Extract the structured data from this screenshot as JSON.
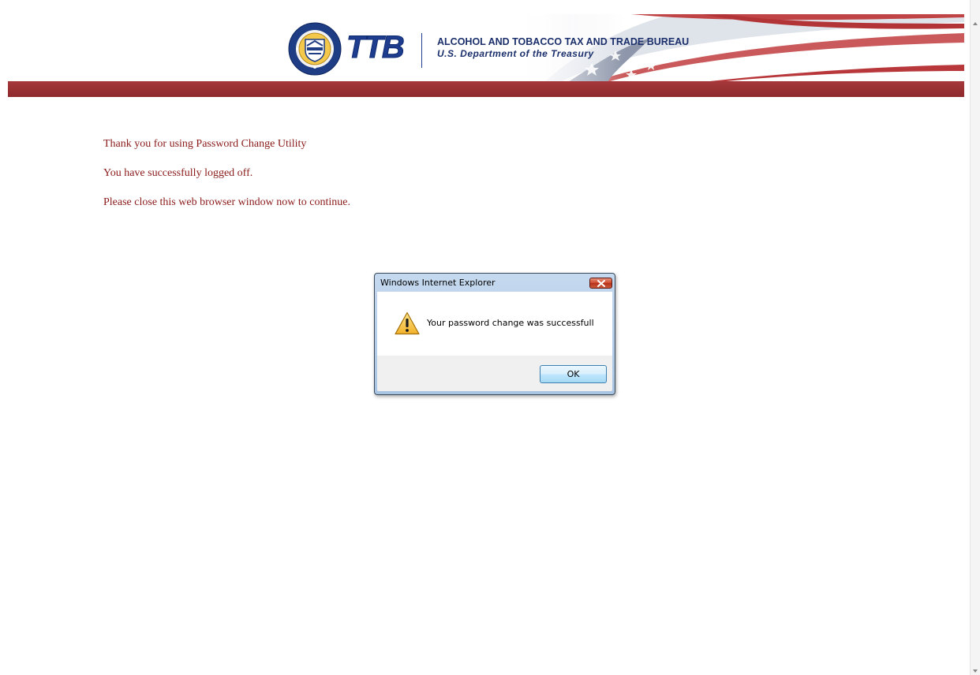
{
  "header": {
    "seal_text": "ALCOHOL AND TOBACCO TAX AND TRADE BUREAU",
    "logo_mark": "TTB",
    "agency_name": "ALCOHOL AND TOBACCO TAX AND TRADE BUREAU",
    "department": "U.S. Department of the Treasury",
    "brand_colors": {
      "navy": "#1e3d8f",
      "red_bar": "#9a3234",
      "message_text": "#8b1a1a"
    }
  },
  "messages": {
    "thank_you": "Thank you for using Password Change Utility",
    "logged_off": "You have successfully logged off.",
    "close_window": "Please close this web browser window now to continue."
  },
  "dialog": {
    "title": "Windows Internet Explorer",
    "icon": "warning-icon",
    "message": "Your password change was successfull",
    "ok_label": "OK",
    "close_icon": "close-icon"
  },
  "scrollbar": {
    "up_icon": "scroll-up-arrow-icon",
    "down_icon": "scroll-down-arrow-icon"
  }
}
